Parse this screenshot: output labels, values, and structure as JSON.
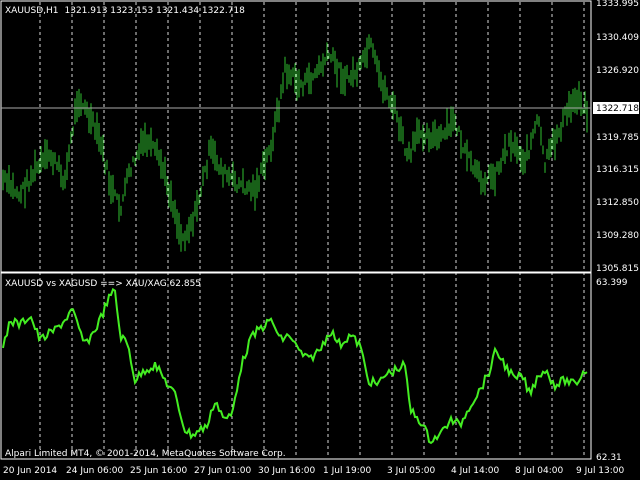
{
  "main_panel": {
    "symbol_info": "XAUUSD,H1",
    "ohlc": "1321.913 1323.153 1321.434 1322.718",
    "bar_color": "#2fbf2f",
    "current_price": "1322.718",
    "price_labels": [
      "1333.995",
      "1330.409",
      "1326.920",
      "1322.718",
      "1319.785",
      "1316.315",
      "1312.850",
      "1309.280",
      "1305.815"
    ]
  },
  "sub_panel": {
    "title": "XAUUSD vs XAGUSD ==> XAU/XAG 62.855",
    "line_color": "#44ee22",
    "scale_top": "63.399",
    "scale_bottom": "62.31"
  },
  "time_axis": [
    "20 Jun 2014",
    "24 Jun 06:00",
    "25 Jun 16:00",
    "27 Jun 01:00",
    "30 Jun 16:00",
    "1 Jul 19:00",
    "3 Jul 05:00",
    "4 Jul 14:00",
    "8 Jul 04:00",
    "9 Jul 13:00"
  ],
  "copyright": "Alpari Limited MT4, © 2001-2014, MetaQuotes Software Corp."
}
